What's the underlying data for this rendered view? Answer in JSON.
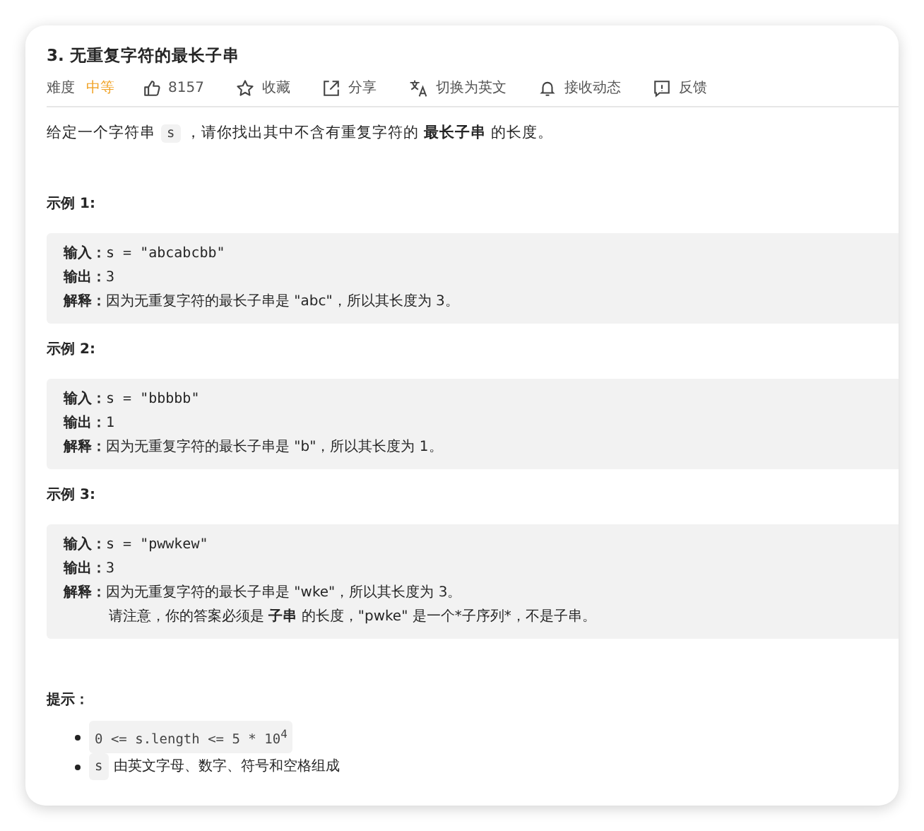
{
  "title": "3. 无重复字符的最长子串",
  "toolbar": [
    {
      "kind": "difficulty",
      "label": "难度",
      "value": "中等"
    },
    {
      "kind": "like",
      "label": "8157"
    },
    {
      "kind": "star",
      "label": "收藏"
    },
    {
      "kind": "share",
      "label": "分享"
    },
    {
      "kind": "translate",
      "label": "切换为英文"
    },
    {
      "kind": "bell",
      "label": "接收动态"
    },
    {
      "kind": "feedback",
      "label": "反馈"
    }
  ],
  "description": {
    "before": "给定一个字符串",
    "code": "s",
    "after": "，请你找出其中不含有重复字符的 **最长子串** 的长度。"
  },
  "examples": [
    {
      "heading": "示例 1:",
      "lines": [
        {
          "kind": "input",
          "label": "输入：",
          "text": "s = \"abcabcbb\""
        },
        {
          "kind": "output",
          "label": "输出：",
          "text": "3"
        },
        {
          "kind": "explanation",
          "label": "解释：",
          "text": "因为无重复字符的最长子串是 \"abc\"，所以其长度为 3。"
        }
      ]
    },
    {
      "heading": "示例 2:",
      "lines": [
        {
          "kind": "input",
          "label": "输入：",
          "text": "s = \"bbbbb\""
        },
        {
          "kind": "output",
          "label": "输出：",
          "text": "1"
        },
        {
          "kind": "explanation",
          "label": "解释：",
          "text": "因为无重复字符的最长子串是 \"b\"，所以其长度为 1。"
        }
      ]
    },
    {
      "heading": "示例 3:",
      "lines": [
        {
          "kind": "input",
          "label": "输入：",
          "text": "s = \"pwwkew\""
        },
        {
          "kind": "output",
          "label": "输出：",
          "text": "3"
        },
        {
          "kind": "explanation",
          "label": "解释：",
          "text": "因为无重复字符的最长子串是 \"wke\"，所以其长度为 3。"
        },
        {
          "kind": "note",
          "text": "请注意，你的答案必须是 **子串** 的长度，\"pwke\" 是一个*子序列*，不是子串。"
        }
      ]
    }
  ],
  "hints": {
    "heading": "提示：",
    "items": [
      {
        "code": "0 <= s.length <= 5 * 10$^{4}$"
      },
      {
        "code": "s",
        "text": "由英文字母、数字、符号和空格组成"
      }
    ]
  }
}
